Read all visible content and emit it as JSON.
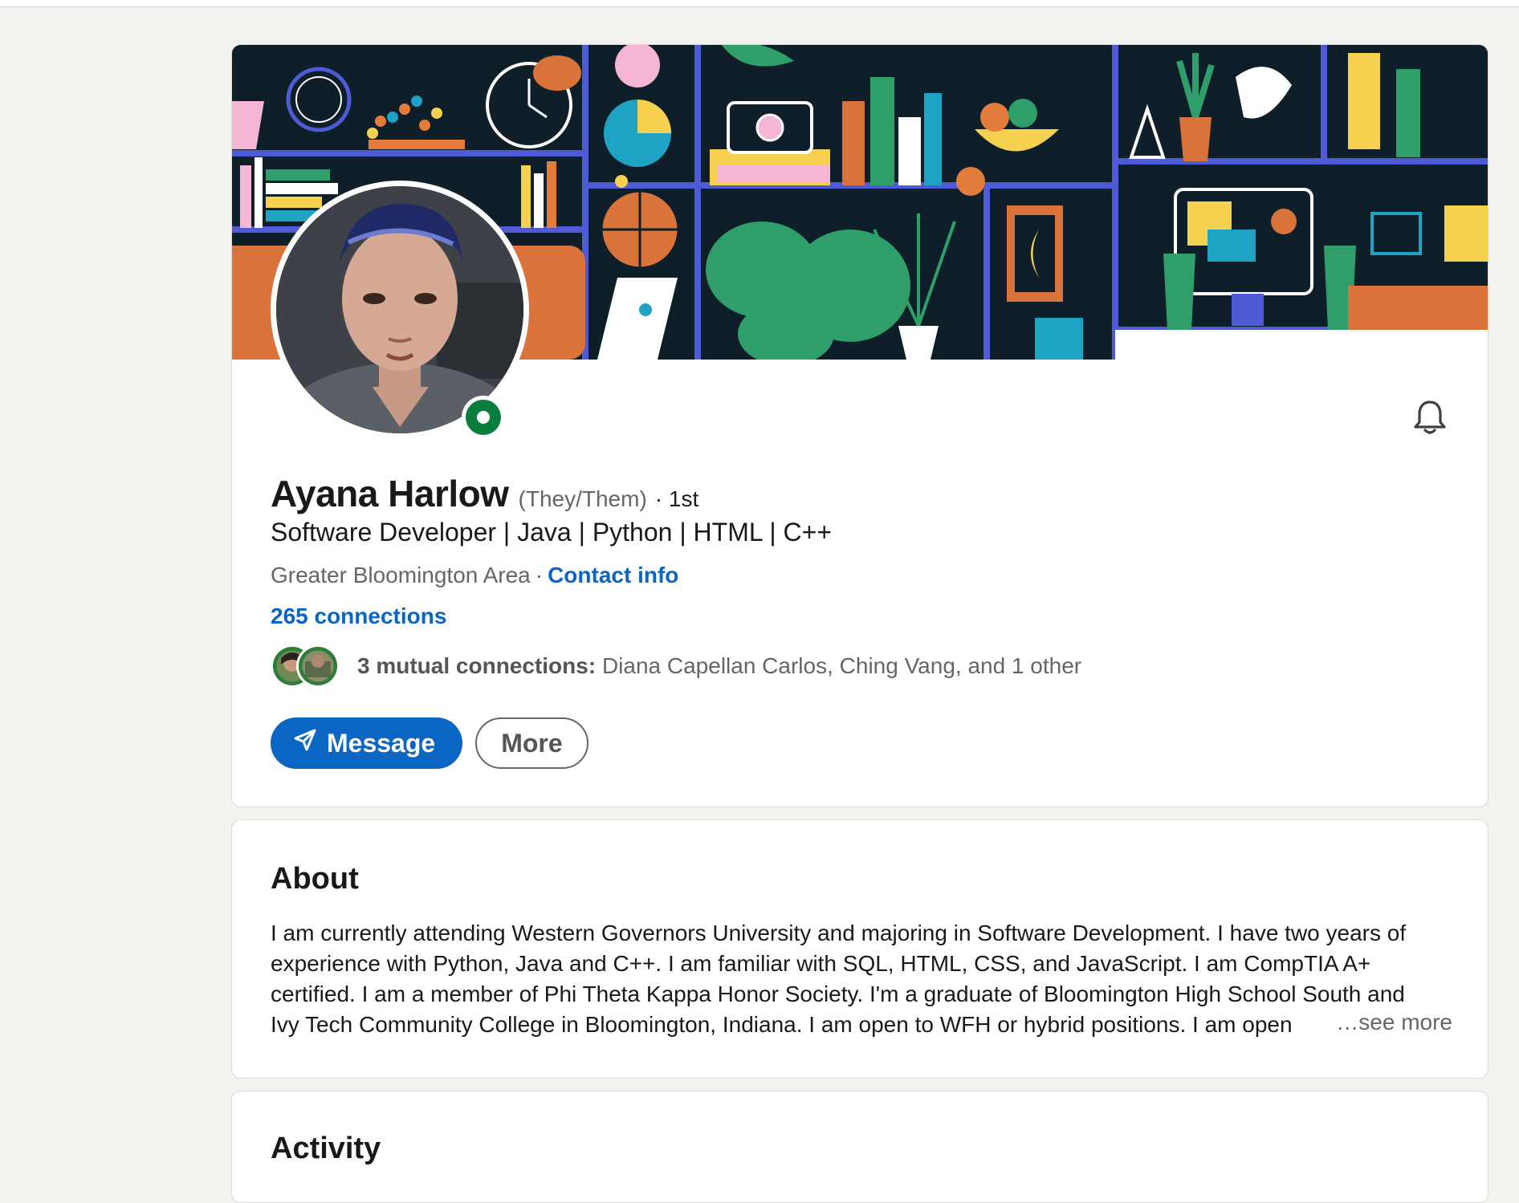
{
  "profile": {
    "name": "Ayana Harlow",
    "pronouns": "(They/Them)",
    "degree": "· 1st",
    "headline": "Software Developer | Java | Python | HTML | C++",
    "location": "Greater Bloomington Area",
    "location_separator": "·",
    "contact_info_label": "Contact info",
    "connections_label": "265 connections",
    "mutual": {
      "count_label": "3 mutual connections:",
      "names": "Diana Capellan Carlos, Ching Vang, and 1 other"
    },
    "buttons": {
      "message_label": "Message",
      "more_label": "More"
    },
    "icons": {
      "bell": "bell-icon",
      "send": "send-icon",
      "online": "online-status-icon"
    },
    "colors": {
      "accent": "#0a66c2",
      "online": "#0a7e3e",
      "page_bg": "#f3f2ef"
    }
  },
  "about": {
    "title": "About",
    "lines": [
      "I am currently attending Western Governors University and majoring in Software Development. I have two years of",
      "experience with Python, Java and C++. I am familiar with SQL, HTML, CSS, and JavaScript. I am CompTIA A+",
      "certified. I am a member of Phi Theta Kappa Honor Society. I'm a graduate of Bloomington High School South and",
      "Ivy Tech Community College in Bloomington, Indiana. I am open to WFH or hybrid positions. I am open"
    ],
    "see_more_label": "…see more"
  },
  "activity": {
    "title": "Activity"
  }
}
